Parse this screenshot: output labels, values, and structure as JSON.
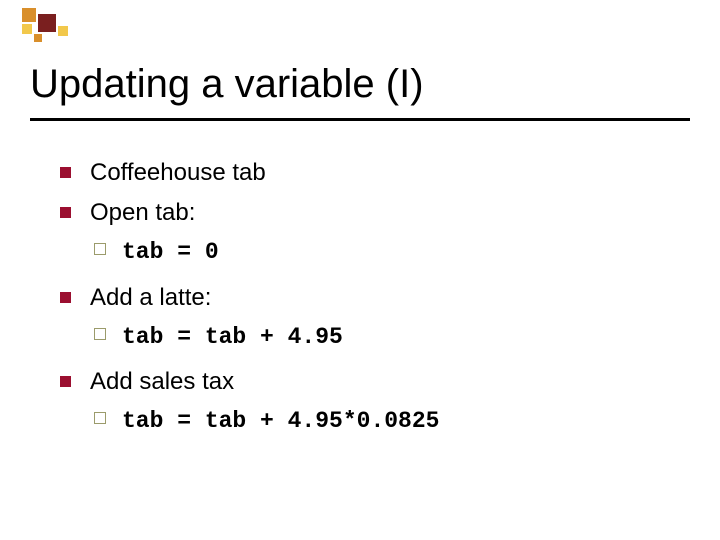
{
  "deco": {
    "c_dark": "#7a1f1f",
    "c_orange": "#d98f2b",
    "c_yellow": "#f2c84b"
  },
  "title": "Updating a variable (I)",
  "bullets": {
    "b1": "Coffeehouse tab",
    "b2": "Open tab:",
    "b2_code": "tab = 0",
    "b3": "Add a latte:",
    "b3_code": "tab = tab + 4.95",
    "b4": "Add sales tax",
    "b4_code": "tab =  tab + 4.95*0.0825"
  }
}
